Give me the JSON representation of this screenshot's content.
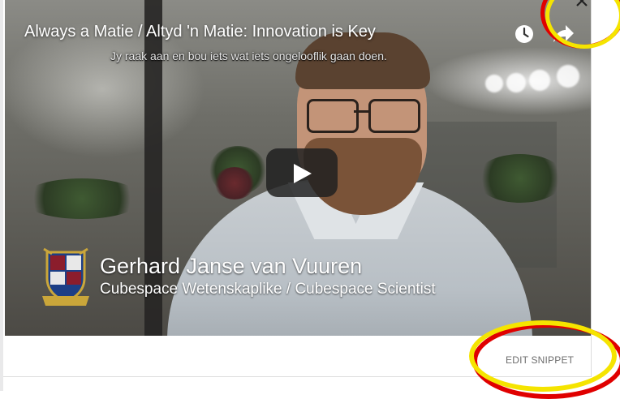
{
  "video": {
    "title": "Always a Matie / Altyd 'n Matie: Innovation is Key",
    "subtitle": "Jy raak aan en bou iets wat iets ongelooflik gaan doen.",
    "speaker_name": "Gerhard Janse van Vuuren",
    "speaker_role": "Cubespace Wetenskaplike / Cubespace Scientist",
    "icons": {
      "watch_later": "clock-icon",
      "share": "share-icon",
      "play": "play-icon",
      "logo": "university-crest-icon"
    }
  },
  "footer": {
    "edit_snippet_label": "EDIT SNIPPET"
  },
  "dialog": {
    "close_icon": "close-icon"
  },
  "annotations": {
    "ring_colors": [
      "#e00000",
      "#f5e400"
    ]
  }
}
